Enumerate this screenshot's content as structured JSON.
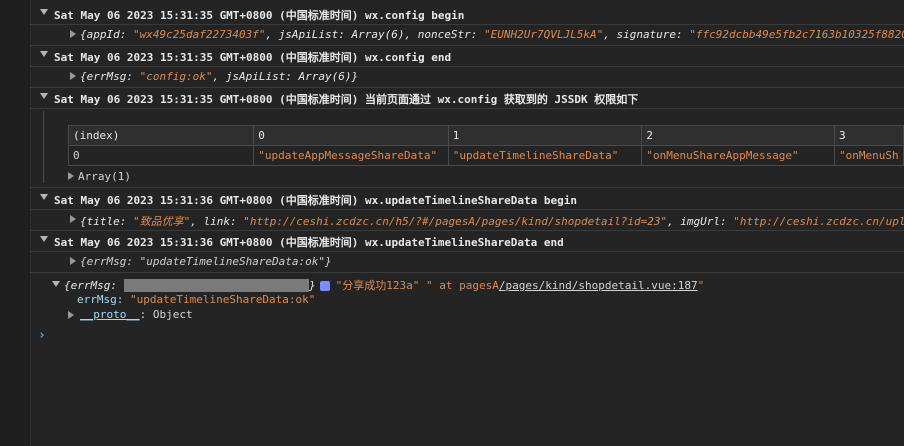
{
  "logs": {
    "g1": "Sat May 06 2023 15:31:35 GMT+0800 (中国标准时间) wx.config begin",
    "r1": {
      "k1": "{appId: ",
      "v1": "\"wx49c25daf2273403f\"",
      "k2": ", jsApiList: Array(6), nonceStr: ",
      "v2": "\"EUNH2Ur7QVLJL5kA\"",
      "k3": ", signature: ",
      "v3": "\"ffc92dcbb49e5fb2c7163b10325f8820"
    },
    "g2": "Sat May 06 2023 15:31:35 GMT+0800 (中国标准时间) wx.config end",
    "r2": {
      "k1": "{errMsg: ",
      "v1": "\"config:ok\"",
      "k2": ", jsApiList: Array(6)}"
    },
    "g3": "Sat May 06 2023 15:31:35 GMT+0800 (中国标准时间) 当前页面通过 wx.config 获取到的 JSSDK 权限如下",
    "table": {
      "headers": [
        "(index)",
        "0",
        "1",
        "2",
        "3"
      ],
      "row_index": "0",
      "cells": [
        "\"updateAppMessageShareData\"",
        "\"updateTimelineShareData\"",
        "\"onMenuShareAppMessage\"",
        "\"onMenuSh"
      ],
      "array_label": "Array(1)"
    },
    "g4": "Sat May 06 2023 15:31:36 GMT+0800 (中国标准时间) wx.updateTimelineShareData begin",
    "r4": {
      "k1": "{title: ",
      "v1": "\"致品优享\"",
      "k2": ", link: ",
      "v2": "\"http://ceshi.zcdzc.cn/h5/?#/pagesA/pages/kind/shopdetail?id=23\"",
      "k3": ", imgUrl: ",
      "v3": "\"http://ceshi.zcdzc.cn/upl"
    },
    "g5": "Sat May 06 2023 15:31:36 GMT+0800 (中国标准时间) wx.updateTimelineShareData end",
    "r5": {
      "v1": "{errMsg: \"updateTimelineShareData:ok\"}"
    }
  },
  "object_log": {
    "prefix": "{errMsg: ",
    "hidden_value": "\"updateTimelineShareData:ok\"",
    "suffix": "}",
    "message": "\"分享成功123a\" \" at pagesA",
    "link": "/pages/kind/shopdetail.vue:187",
    "tail": "\"",
    "prop_key": "errMsg: ",
    "prop_value": "\"updateTimelineShareData:ok\"",
    "proto_key": "__proto__",
    "proto_value": ": Object"
  },
  "prompt_symbol": "›",
  "colors": {
    "background": "#242424",
    "string": "#e08a4b",
    "link_blue": "#4a9eff",
    "badge": "#7b8cff"
  }
}
